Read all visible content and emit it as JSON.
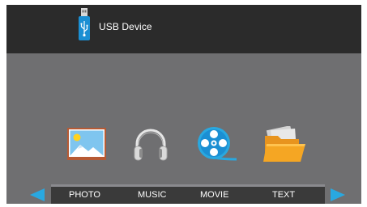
{
  "header": {
    "device_label": "USB Device",
    "icon": "usb-drive-icon"
  },
  "media": {
    "items": [
      {
        "label": "PHOTO",
        "icon": "photo-icon"
      },
      {
        "label": "MUSIC",
        "icon": "headphones-icon"
      },
      {
        "label": "MOVIE",
        "icon": "film-reel-icon"
      },
      {
        "label": "TEXT",
        "icon": "folder-icon"
      }
    ]
  },
  "navigation": {
    "left_icon": "arrow-left-icon",
    "right_icon": "arrow-right-icon"
  },
  "colors": {
    "background": "#6f6f71",
    "header": "#2b2b2b",
    "menu_bar": "#3a3a3a",
    "accent_blue": "#29a8e0",
    "folder_orange": "#f5a623"
  }
}
